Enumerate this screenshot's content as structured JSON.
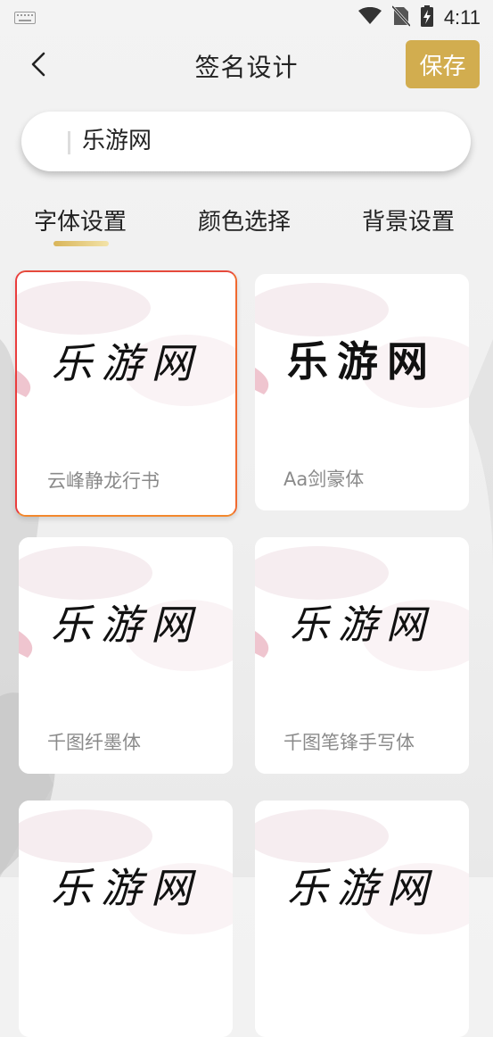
{
  "statusbar": {
    "time": "4:11",
    "icons": [
      "keyboard-icon",
      "wifi-icon",
      "no-sim-icon",
      "battery-charging-icon"
    ]
  },
  "header": {
    "title": "签名设计",
    "save_label": "保存",
    "back_icon": "chevron-left-icon"
  },
  "input": {
    "value": "乐游网"
  },
  "tabs": [
    {
      "label": "字体设置",
      "active": true
    },
    {
      "label": "颜色选择",
      "active": false
    },
    {
      "label": "背景设置",
      "active": false
    }
  ],
  "fonts": [
    {
      "sample": "乐游网",
      "name": "云峰静龙行书",
      "selected": true
    },
    {
      "sample": "乐游网",
      "name": "Aa剑豪体",
      "selected": false
    },
    {
      "sample": "乐游网",
      "name": "千图纤墨体",
      "selected": false
    },
    {
      "sample": "乐游网",
      "name": "千图笔锋手写体",
      "selected": false
    },
    {
      "sample": "乐游网",
      "name": "",
      "selected": false
    },
    {
      "sample": "乐游网",
      "name": "",
      "selected": false
    }
  ],
  "colors": {
    "accent": "#d2ad4f",
    "selected_border": "#ee5a35"
  }
}
